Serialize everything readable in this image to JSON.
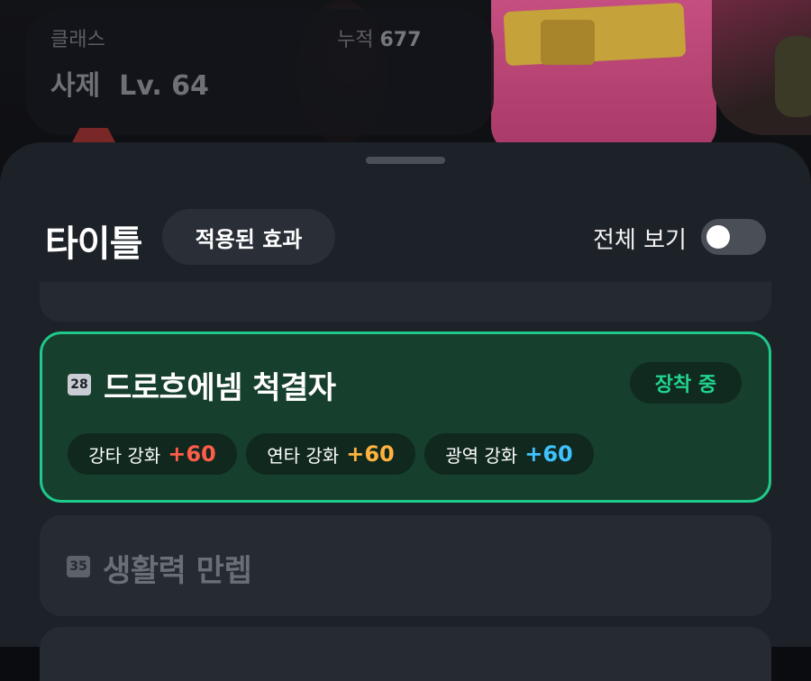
{
  "profile": {
    "class_label": "클래스",
    "class_value": "사제  Lv. 64",
    "total_label": "누적",
    "total_value": "677"
  },
  "sheet": {
    "title": "타이틀",
    "effects_button": "적용된 효과",
    "view_all_label": "전체 보기",
    "view_all_on": false
  },
  "titles": [
    {
      "number": "28",
      "name": "드로흐에넴 척결자",
      "status": "장착 중",
      "stats": [
        {
          "name": "강타 강화",
          "bonus": "+60",
          "color": "#ff5d4a"
        },
        {
          "name": "연타 강화",
          "bonus": "+60",
          "color": "#ffb23e"
        },
        {
          "name": "광역 강화",
          "bonus": "+60",
          "color": "#3fc3ff"
        }
      ]
    },
    {
      "number": "35",
      "name": "생활력 만렙"
    }
  ],
  "colors": {
    "accent": "#1ec98a",
    "sheet_bg": "#1d2128",
    "active_card_bg": "#173f2d"
  }
}
